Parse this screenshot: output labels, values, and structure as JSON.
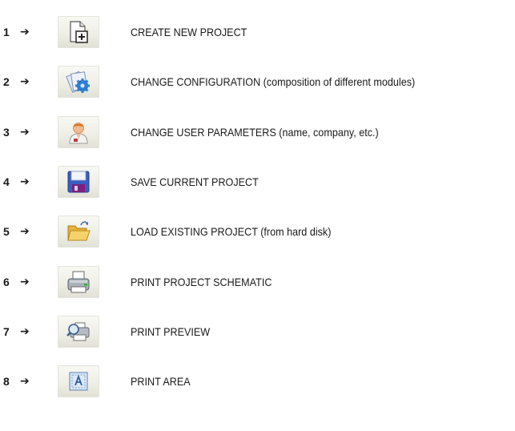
{
  "arrow": "➔",
  "items": [
    {
      "number": "1",
      "icon": "new-project-icon",
      "label": "CREATE NEW PROJECT"
    },
    {
      "number": "2",
      "icon": "configuration-gear-icon",
      "label": "CHANGE CONFIGURATION (composition of different modules)"
    },
    {
      "number": "3",
      "icon": "user-icon",
      "label": "CHANGE USER PARAMETERS (name, company, etc.)"
    },
    {
      "number": "4",
      "icon": "floppy-disk-icon",
      "label": "SAVE CURRENT PROJECT"
    },
    {
      "number": "5",
      "icon": "open-folder-icon",
      "label": "LOAD EXISTING PROJECT (from hard disk)"
    },
    {
      "number": "6",
      "icon": "printer-icon",
      "label": "PRINT PROJECT SCHEMATIC"
    },
    {
      "number": "7",
      "icon": "print-preview-icon",
      "label": "PRINT PREVIEW"
    },
    {
      "number": "8",
      "icon": "print-area-icon",
      "label": "PRINT AREA"
    }
  ]
}
